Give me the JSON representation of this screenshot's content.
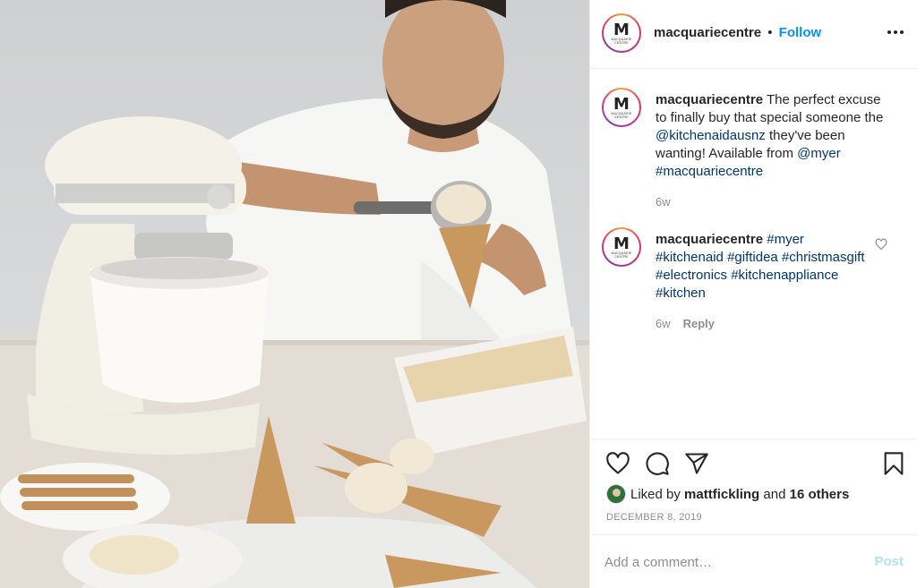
{
  "post": {
    "account": "macquariecentre",
    "separator": "•",
    "follow_label": "Follow",
    "avatar": {
      "letter": "M",
      "subtext": "MACQUARIE CENTRE"
    }
  },
  "caption": {
    "username": "macquariecentre",
    "text_1": " The perfect excuse to finally buy that special someone the ",
    "mention_1": "@kitchenaidausnz",
    "text_2": " they've been wanting! Available from ",
    "mention_2": "@myer",
    "hashtag": "#macquariecentre",
    "age": "6w"
  },
  "comment": {
    "username": "macquariecentre",
    "tags": [
      "#myer",
      "#kitchenaid",
      "#giftidea",
      "#christmasgift",
      "#electronics",
      "#kitchenappliance",
      "#kitchen"
    ],
    "age": "6w",
    "reply_label": "Reply"
  },
  "likes": {
    "prefix": "Liked by ",
    "user": "mattfickling",
    "middle": " and ",
    "others": "16 others"
  },
  "date": "DECEMBER 8, 2019",
  "add_comment": {
    "placeholder": "Add a comment…",
    "post_label": "Post"
  },
  "icons": [
    "heart-icon",
    "comment-icon",
    "share-icon",
    "bookmark-icon",
    "more-options-icon",
    "small-heart-icon"
  ],
  "colors": {
    "link": "#00376b",
    "follow": "#0095f6",
    "muted": "#8e8e8e",
    "post_disabled": "#b2dffc"
  }
}
